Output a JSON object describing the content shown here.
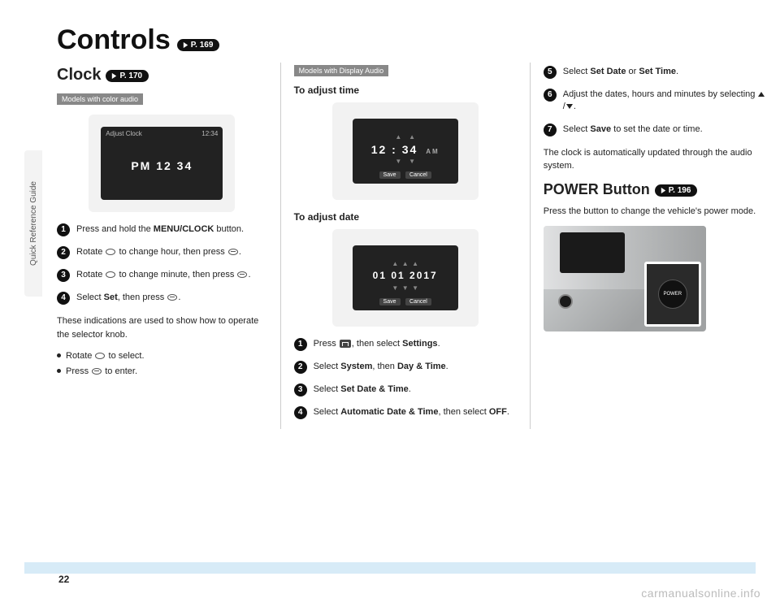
{
  "side_tab": "Quick Reference Guide",
  "title": "Controls",
  "title_ref": "P. 169",
  "page_number": "22",
  "watermark": "carmanualsonline.info",
  "col1": {
    "heading": "Clock",
    "heading_ref": "P. 170",
    "model_label": "Models with color audio",
    "screen_title": "Adjust Clock",
    "screen_time": "12:34",
    "screen_main": "PM 12 34",
    "steps": [
      {
        "n": "1",
        "pre": "Press and hold the ",
        "b": "MENU/CLOCK",
        "post": " button."
      },
      {
        "n": "2",
        "pre": "Rotate ",
        "icon": "knob",
        "mid": " to change hour, then press ",
        "icon2": "knobflat",
        "post": "."
      },
      {
        "n": "3",
        "pre": "Rotate ",
        "icon": "knob",
        "mid": " to change minute, then press ",
        "icon2": "knobflat",
        "post": "."
      },
      {
        "n": "4",
        "pre": "Select ",
        "b": "Set",
        "mid": ", then press ",
        "icon2": "knobflat",
        "post": "."
      }
    ],
    "postnote": "These indications are used to show how to operate the selector knob.",
    "bullets": [
      {
        "pre": "Rotate ",
        "icon": "knob",
        "post": " to select."
      },
      {
        "pre": "Press ",
        "icon": "knobflat",
        "post": " to enter."
      }
    ]
  },
  "col2": {
    "model_label": "Models with Display Audio",
    "head1": "To adjust time",
    "screen1_digits": "12 : 34",
    "screen1_ampm": "AM",
    "screen1_save": "Save",
    "screen1_cancel": "Cancel",
    "head2": "To adjust date",
    "screen2_digits": "01  01  2017",
    "screen2_save": "Save",
    "screen2_cancel": "Cancel",
    "steps": [
      {
        "n": "1",
        "pre": "Press ",
        "icon": "home",
        "mid": ", then select ",
        "b": "Settings",
        "post": "."
      },
      {
        "n": "2",
        "pre": "Select ",
        "b": "System",
        "mid": ", then ",
        "b2": "Day & Time",
        "post": "."
      },
      {
        "n": "3",
        "pre": "Select ",
        "b": "Set Date & Time",
        "post": "."
      },
      {
        "n": "4",
        "pre": "Select ",
        "b": "Automatic Date & Time",
        "mid": ", then select ",
        "b2": "OFF",
        "post": "."
      }
    ]
  },
  "col3": {
    "steps": [
      {
        "n": "5",
        "pre": "Select ",
        "b": "Set Date",
        "mid": " or ",
        "b2": "Set Time",
        "post": "."
      },
      {
        "n": "6",
        "pre": "Adjust the dates, hours and minutes by selecting ",
        "icons": "updown",
        "post": "."
      },
      {
        "n": "7",
        "pre": "Select ",
        "b": "Save",
        "post": " to set the date or time."
      }
    ],
    "note": "The clock is automatically updated through the audio system.",
    "heading": "POWER Button",
    "heading_ref": "P. 196",
    "subnote": "Press the button to change the vehicle's power mode.",
    "power_label": "POWER"
  }
}
